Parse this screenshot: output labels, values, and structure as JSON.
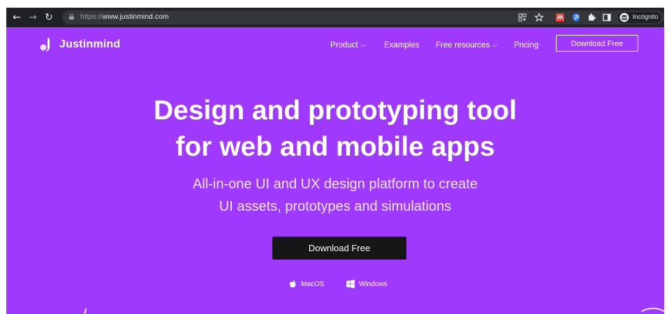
{
  "browser": {
    "url_scheme": "https://",
    "url_host": "www.justinmind.com",
    "profile_label": "Incógnito"
  },
  "site": {
    "logo_text": "Justinmind",
    "nav": {
      "product": "Product",
      "examples": "Examples",
      "free_resources": "Free resources",
      "pricing": "Pricing",
      "download": "Download Free"
    },
    "hero": {
      "title_line1": "Design and prototyping tool",
      "title_line2": "for web and mobile apps",
      "subtitle_line1": "All-in-one UI and UX design platform to create",
      "subtitle_line2": "UI assets, prototypes and simulations",
      "cta": "Download Free"
    },
    "platforms": {
      "mac": "MacOS",
      "windows": "Windows"
    }
  },
  "colors": {
    "brand_purple": "#9e39fd",
    "cta_dark": "#161616",
    "chrome_dark": "#202124"
  }
}
